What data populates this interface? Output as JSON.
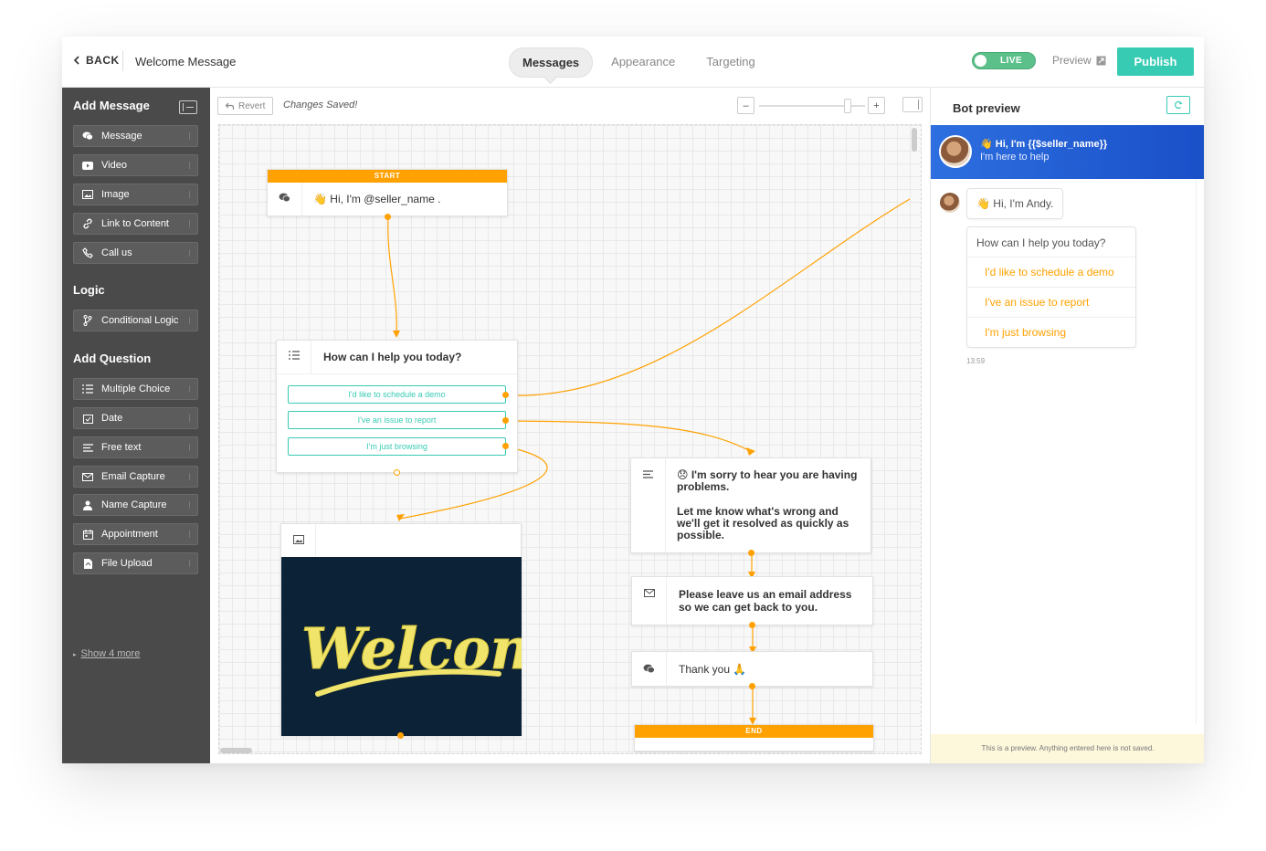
{
  "header": {
    "back_label": "BACK",
    "page_title": "Welcome Message",
    "tabs": [
      "Messages",
      "Appearance",
      "Targeting"
    ],
    "live_label": "LIVE",
    "preview_label": "Preview",
    "publish_label": "Publish"
  },
  "sidebar": {
    "add_message_title": "Add Message",
    "message_items": [
      "Message",
      "Video",
      "Image",
      "Link to Content",
      "Call us"
    ],
    "logic_title": "Logic",
    "logic_items": [
      "Conditional Logic"
    ],
    "add_question_title": "Add Question",
    "question_items": [
      "Multiple Choice",
      "Date",
      "Free text",
      "Email Capture",
      "Name Capture",
      "Appointment",
      "File Upload"
    ],
    "show_more": "Show 4 more"
  },
  "canvas_toolbar": {
    "revert_label": "Revert",
    "status": "Changes Saved!",
    "zoom_minus": "–",
    "zoom_plus": "+"
  },
  "flow": {
    "start_label": "START",
    "start_text": "👋 Hi, I'm @seller_name .",
    "question_text": "How can I help you today?",
    "choices": [
      "I'd like to schedule a demo",
      "I've an issue to report",
      "I'm just browsing"
    ],
    "sorry_line1": "😞 I'm sorry to hear you are having problems.",
    "sorry_line2": "Let me know what's wrong and we'll get it resolved as quickly as possible.",
    "email_text": "Please leave us an email address so we can get back to you.",
    "thanks_text": "Thank you 🙏",
    "end_label": "END",
    "image_text": "Welcome"
  },
  "bot_preview": {
    "title": "Bot preview",
    "header_line1": "👋 Hi, I'm {{$seller_name}}",
    "header_line2": "I'm here to help",
    "greeting": "👋 Hi, I'm Andy.",
    "question": "How can I help you today?",
    "options": [
      "I'd like to schedule a demo",
      "I've an issue to report",
      "I'm just browsing"
    ],
    "timestamp": "13:59",
    "footer": "This is a preview. Anything entered here is not saved."
  },
  "colors": {
    "accent": "#38cbb4",
    "orange": "#ffa100",
    "sidebar": "#4a4a4a",
    "live": "#5cc08a",
    "preview_header": "#2d6fe0"
  }
}
